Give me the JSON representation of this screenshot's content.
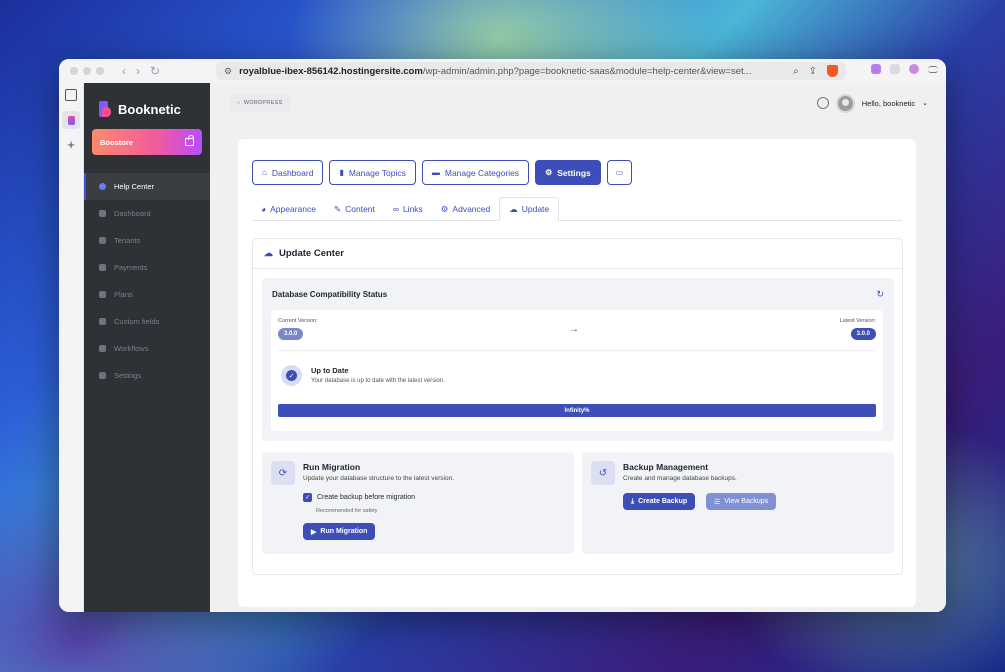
{
  "browser": {
    "url_host": "royalblue-ibex-856142.hostingersite.com",
    "url_path": "/wp-admin/admin.php?page=booknetic-saas&module=help-center&view=set..."
  },
  "app": {
    "brand": "Booknetic",
    "boostore": "Boostore"
  },
  "sidebar": {
    "items": [
      {
        "label": "Help Center",
        "icon": "question-icon"
      },
      {
        "label": "Dashboard",
        "icon": "cube-icon"
      },
      {
        "label": "Tenants",
        "icon": "user-icon"
      },
      {
        "label": "Payments",
        "icon": "card-icon"
      },
      {
        "label": "Plans",
        "icon": "rocket-icon"
      },
      {
        "label": "Custom fields",
        "icon": "wand-icon"
      },
      {
        "label": "Workflows",
        "icon": "flow-icon"
      },
      {
        "label": "Settings",
        "icon": "gear-icon"
      }
    ]
  },
  "topbar": {
    "back": "WORDPRESS",
    "greeting": "Hello, booknetic"
  },
  "tabs": {
    "main": [
      "Dashboard",
      "Manage Topics",
      "Manage Categories",
      "Settings"
    ],
    "sub": [
      "Appearance",
      "Content",
      "Links",
      "Advanced",
      "Update"
    ]
  },
  "update": {
    "title": "Update Center",
    "db_title": "Database Compatibility Status",
    "current_label": "Current Version:",
    "current_version": "3.0.0",
    "latest_label": "Latest Version:",
    "latest_version": "3.0.0",
    "status_title": "Up to Date",
    "status_desc": "Your database is up to date with the latest version.",
    "progress_label": "Infinity%",
    "progress_fraction": 1.0
  },
  "migration": {
    "title": "Run Migration",
    "desc": "Update your database structure to the latest version.",
    "checkbox_label": "Create backup before migration",
    "checkbox_checked": true,
    "hint": "Recommended for safety",
    "button": "Run Migration"
  },
  "backup": {
    "title": "Backup Management",
    "desc": "Create and manage database backups.",
    "create_button": "Create Backup",
    "view_button": "View Backups"
  },
  "colors": {
    "accent": "#3d4eb8",
    "sidebar_bg": "#2e3136"
  }
}
